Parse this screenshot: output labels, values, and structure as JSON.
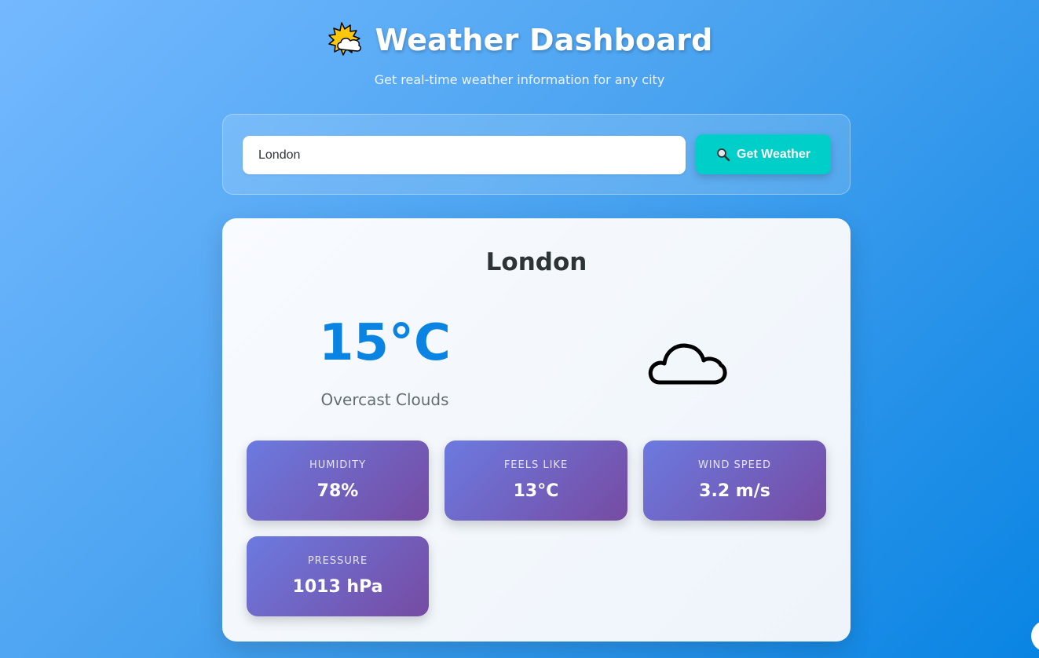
{
  "header": {
    "icon": "sun-behind-cloud-icon",
    "title": "Weather Dashboard",
    "subtitle": "Get real-time weather information for any city"
  },
  "search": {
    "value": "London",
    "button_label": "Get Weather",
    "button_icon": "magnifier-icon"
  },
  "weather": {
    "city": "London",
    "temperature": "15°C",
    "description": "Overcast Clouds",
    "icon": "cloud-icon",
    "stats": {
      "humidity": {
        "label": "HUMIDITY",
        "value": "78%"
      },
      "feels_like": {
        "label": "FEELS LIKE",
        "value": "13°C"
      },
      "wind_speed": {
        "label": "WIND SPEED",
        "value": "3.2 m/s"
      },
      "pressure": {
        "label": "PRESSURE",
        "value": "1013 hPa"
      }
    }
  },
  "colors": {
    "accent_button": "#00cec9",
    "temperature": "#0984e3",
    "stat_gradient_start": "#6c7ae0",
    "stat_gradient_end": "#764ba2"
  }
}
